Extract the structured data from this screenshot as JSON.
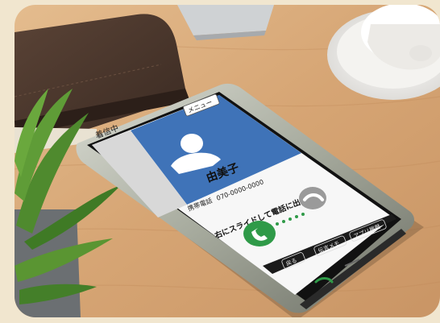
{
  "phone": {
    "status_text": "着信中",
    "menu_label": "メニュー",
    "caller_name": "由美子",
    "phone_label": "携帯電話",
    "phone_number": "070-0000-0000",
    "instruction": "右にスライドして電話に出る",
    "nav_back": "戻る",
    "nav_memo": "伝言メモ",
    "nav_apps": "アプリ履歴"
  },
  "colors": {
    "frame_bg": "#f1e6cf",
    "desk": "#d7a878",
    "screen_header": "#3f73b8",
    "answer_green": "#2f9a48",
    "decline_gray": "#9a9a9a"
  },
  "icons": [
    "avatar-icon",
    "phone-answer-icon",
    "phone-decline-icon",
    "slide-arrows-icon"
  ]
}
